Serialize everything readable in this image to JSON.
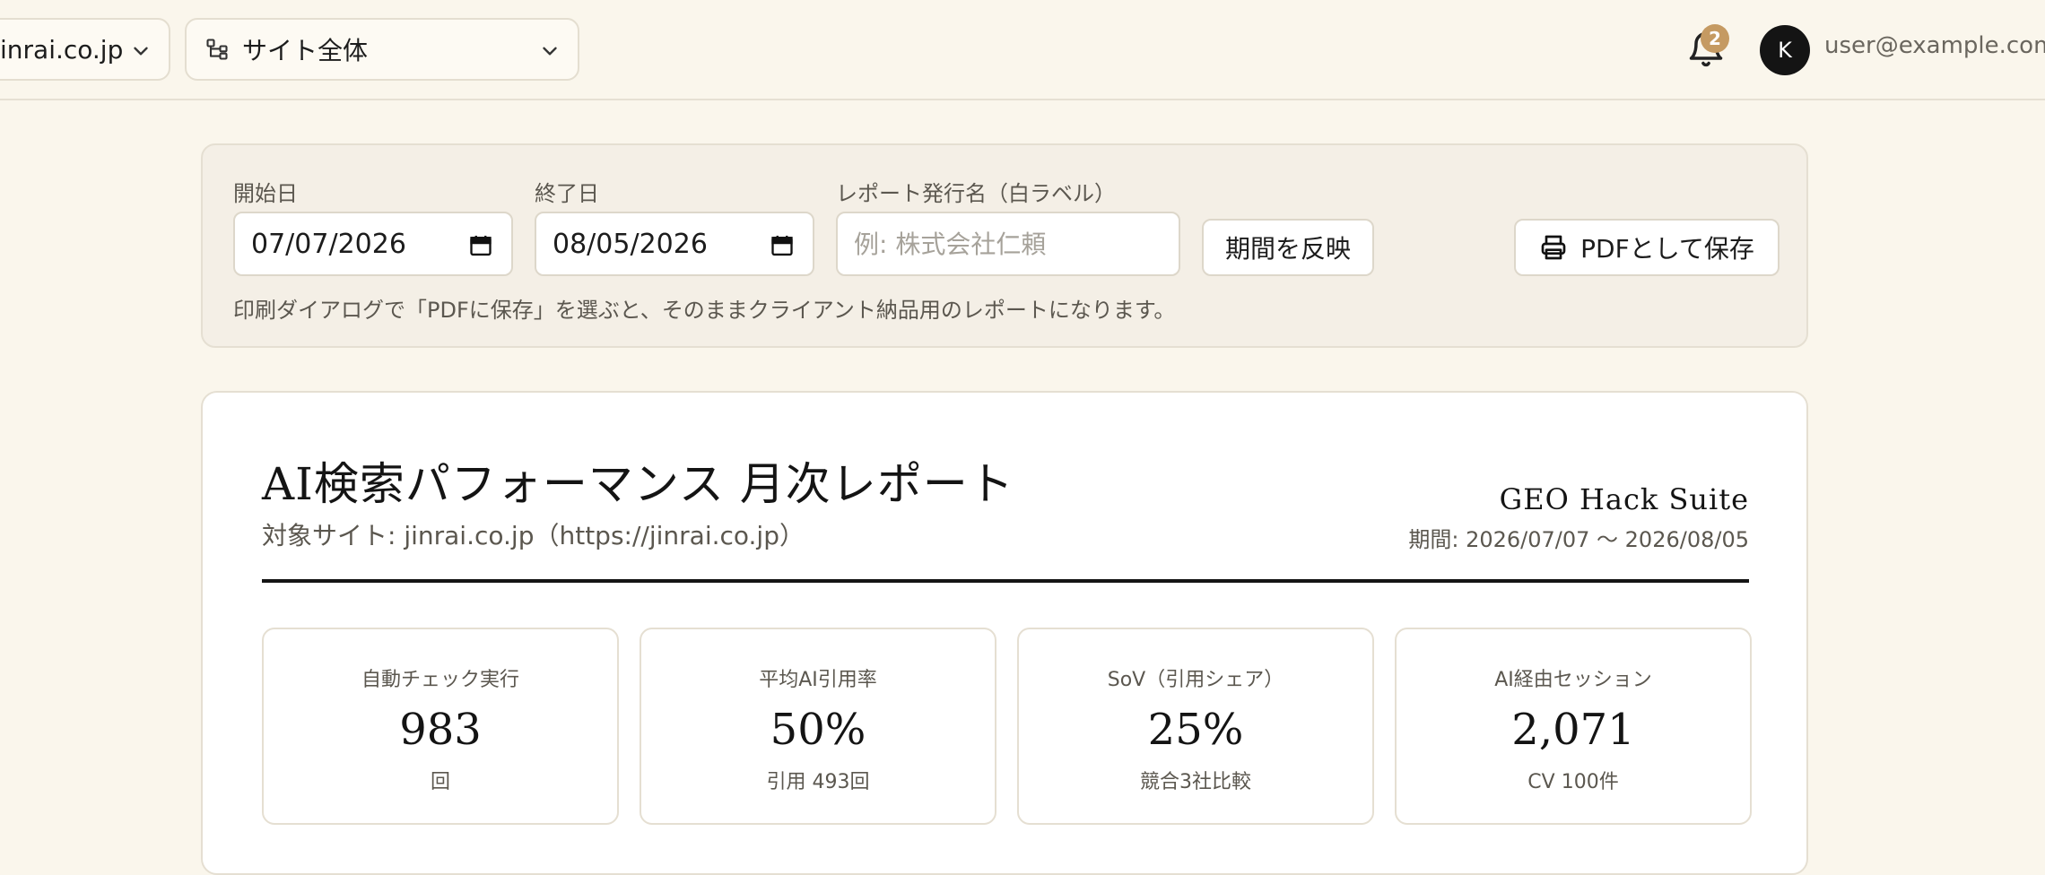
{
  "header": {
    "site_select": "inrai.co.jp",
    "scope_select": "サイト全体",
    "notification_count": "2",
    "avatar_initial": "K",
    "user_email": "user@example.com"
  },
  "controls": {
    "start_label": "開始日",
    "start_value": "07/07/2026",
    "end_label": "終了日",
    "end_value": "08/05/2026",
    "issuer_label": "レポート発行名（白ラベル）",
    "issuer_placeholder": "例: 株式会社仁頼",
    "apply_button": "期間を反映",
    "pdf_button": "PDFとして保存",
    "hint": "印刷ダイアログで「PDFに保存」を選ぶと、そのままクライアント納品用のレポートになります。"
  },
  "report": {
    "title": "AI検索パフォーマンス 月次レポート",
    "subtitle": "対象サイト: jinrai.co.jp（https://jinrai.co.jp）",
    "brand": "GEO Hack Suite",
    "period": "期間: 2026/07/07 〜 2026/08/05",
    "kpis": [
      {
        "label": "自動チェック実行",
        "value": "983",
        "note": "回"
      },
      {
        "label": "平均AI引用率",
        "value": "50%",
        "note": "引用 493回"
      },
      {
        "label": "SoV（引用シェア）",
        "value": "25%",
        "note": "競合3社比較"
      },
      {
        "label": "AI経由セッション",
        "value": "2,071",
        "note": "CV 100件"
      }
    ]
  },
  "icons": {
    "scope": "sitemap-icon",
    "bell": "bell-icon",
    "calendar": "calendar-icon",
    "printer": "printer-icon",
    "chevron": "chevron-down-icon"
  },
  "colors": {
    "page_bg": "#faf6ec",
    "panel_bg": "#f4efe6",
    "badge": "#c59a62",
    "avatar": "#141414"
  }
}
